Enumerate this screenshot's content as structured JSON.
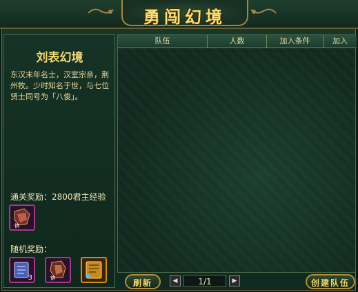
{
  "header": {
    "title": "勇闯幻境"
  },
  "instance": {
    "name": "刘表幻境",
    "description": "东汉末年名士，汉室宗亲，荆州牧。少时知名于世，与七位贤士同号为「八俊」。"
  },
  "rewards": {
    "clear_label": "通关奖励：2800君主经验",
    "clear_items": [
      {
        "icon": "armor-piece-icon",
        "color": "#a13b8b"
      }
    ],
    "random_label": "随机奖励：",
    "random_items": [
      {
        "icon": "scroll-icon",
        "qty": "3",
        "color": "#a13b8b"
      },
      {
        "icon": "armor-piece-icon",
        "qty": "",
        "color": "#a13b8b"
      },
      {
        "icon": "gold-tome-icon",
        "qty": "",
        "color": "#d58a1c"
      }
    ]
  },
  "team_table": {
    "columns": [
      "队伍",
      "人数",
      "加入条件",
      "加入"
    ],
    "rows": []
  },
  "buttons": {
    "refresh": "刷新",
    "create_team": "创建队伍"
  },
  "pagination": {
    "current": "1/1"
  }
}
